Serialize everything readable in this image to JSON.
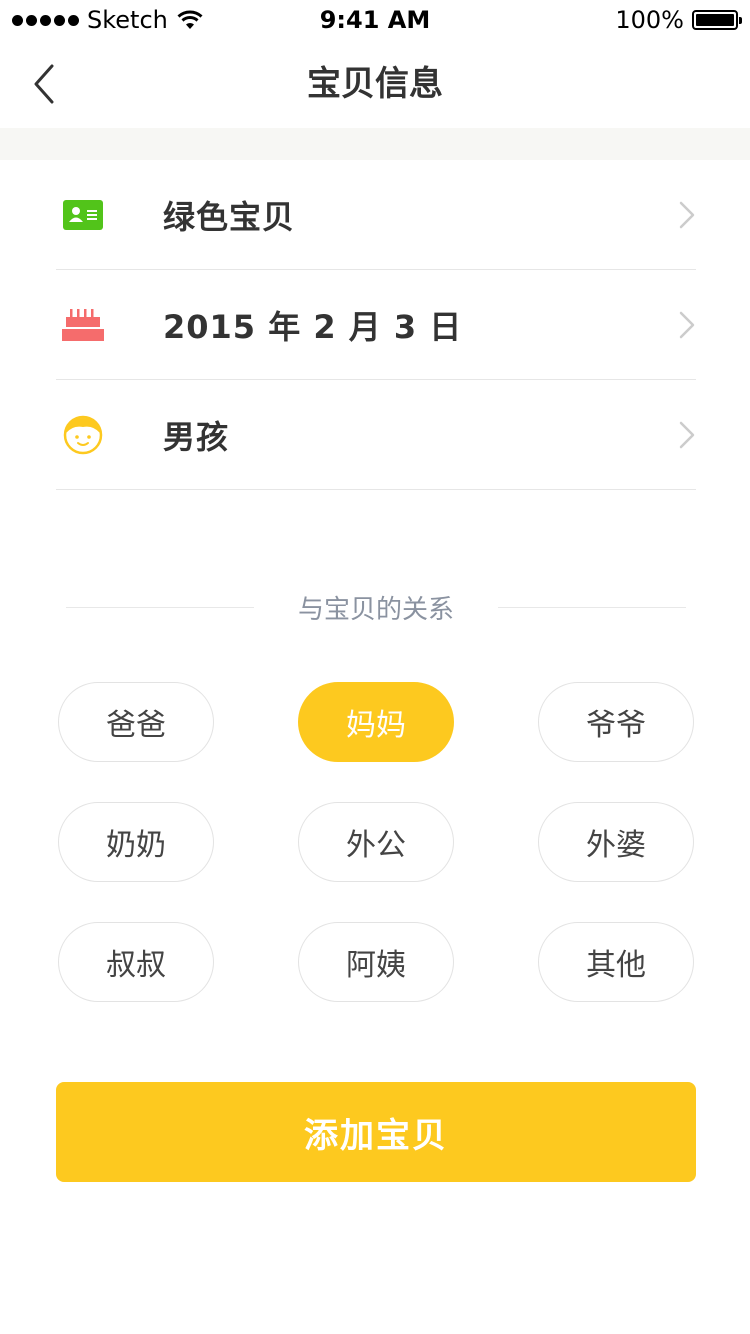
{
  "status_bar": {
    "carrier": "Sketch",
    "time": "9:41 AM",
    "battery_percent_label": "100%",
    "battery_level": 1.0,
    "signal_icon": "signal-dots-icon",
    "wifi_icon": "wifi-icon",
    "battery_icon": "battery-icon"
  },
  "nav": {
    "title": "宝贝信息",
    "back_icon": "chevron-left-icon"
  },
  "info_rows": [
    {
      "icon": "id-card-icon",
      "icon_color": "#52c41a",
      "text": "绿色宝贝"
    },
    {
      "icon": "birthday-cake-icon",
      "icon_color": "#f56c6c",
      "text": "2015 年 2 月 3 日"
    },
    {
      "icon": "boy-face-icon",
      "icon_color": "#fdc91f",
      "text": "男孩"
    }
  ],
  "relation_section": {
    "title": "与宝贝的关系",
    "options": [
      "爸爸",
      "妈妈",
      "爷爷",
      "奶奶",
      "外公",
      "外婆",
      "叔叔",
      "阿姨",
      "其他"
    ],
    "selected": "妈妈"
  },
  "add_button": {
    "label": "添加宝贝"
  },
  "colors": {
    "accent": "#fdc91f",
    "text_primary": "#333333",
    "text_secondary": "#8a92a0",
    "divider": "#e6e6e6",
    "band_background": "#f7f7f4"
  }
}
